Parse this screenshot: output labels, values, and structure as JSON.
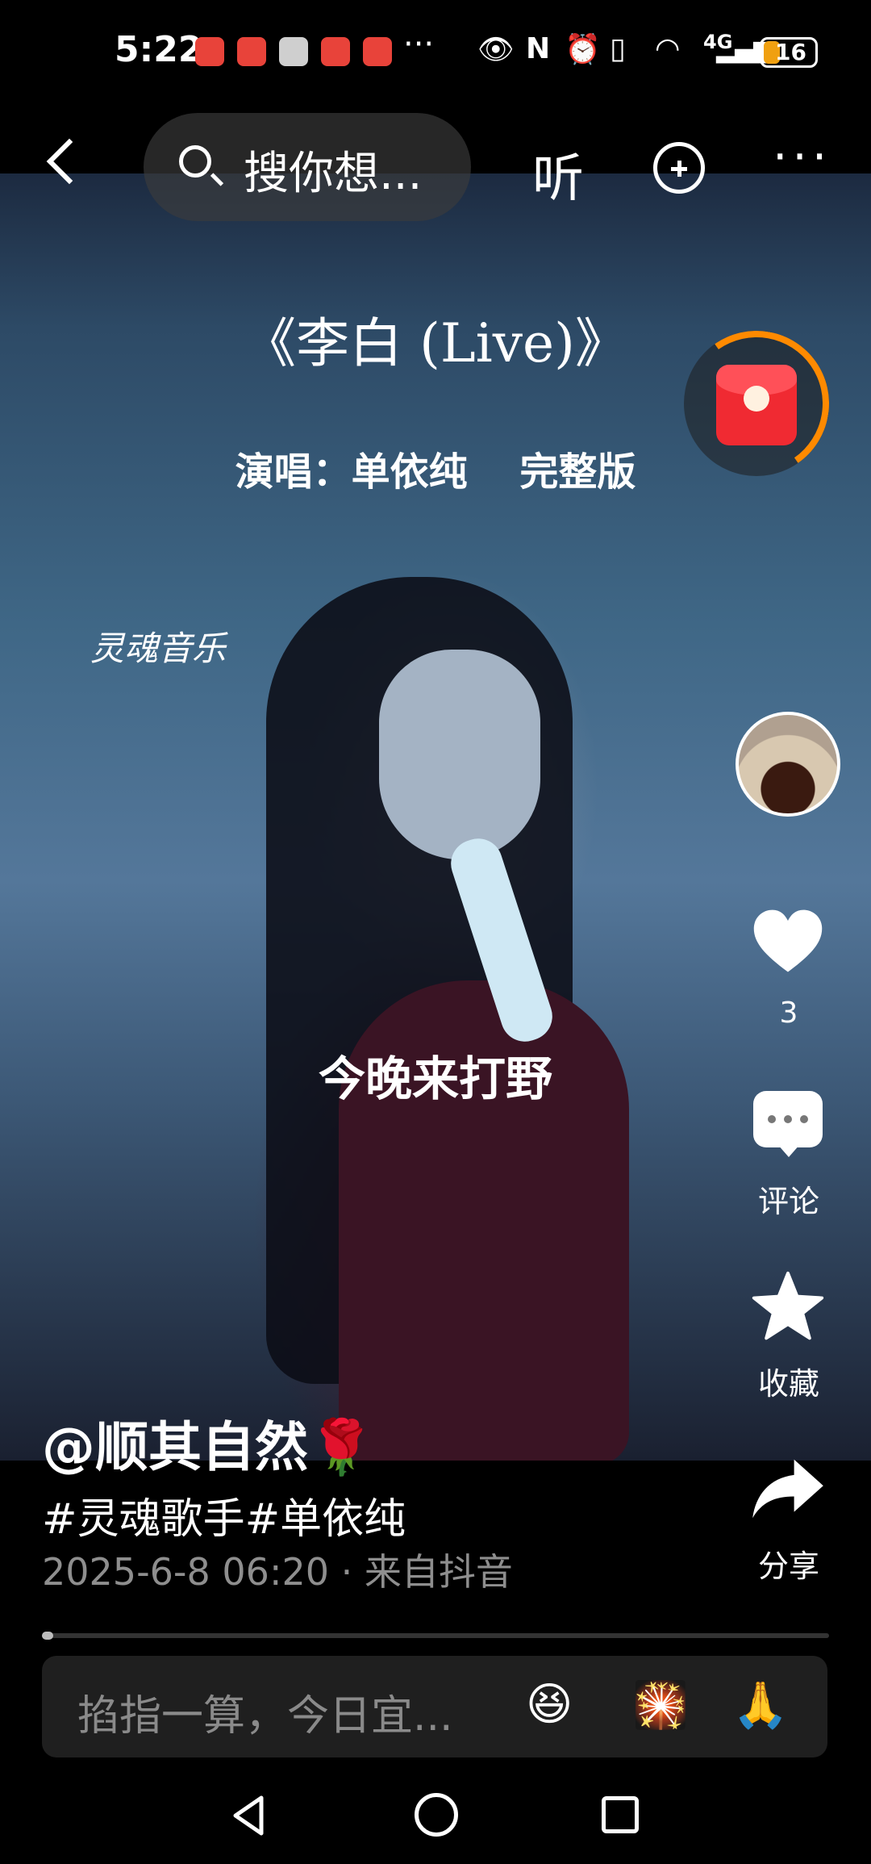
{
  "status_bar": {
    "time": "5:22",
    "more": "···",
    "network": "4G",
    "battery": "16"
  },
  "top_nav": {
    "search_placeholder": "搜你想...",
    "listen_label": "听",
    "more_label": "···"
  },
  "video": {
    "title": "《李白 (Live)》",
    "subtitle": "演唱：单依纯　 完整版",
    "watermark": "灵魂音乐",
    "lyric": "今晚来打野"
  },
  "right_rail": {
    "like_count": "3",
    "comment_label": "评论",
    "favorite_label": "收藏",
    "share_label": "分享"
  },
  "post": {
    "author": "@顺其自然🌹",
    "hashtags": "#灵魂歌手#单依纯",
    "meta": "2025-6-8 06:20 · 来自抖音"
  },
  "progress": {
    "fraction": 0.01
  },
  "comment_bar": {
    "placeholder": "掐指一算，今日宜...",
    "emojis": [
      "😆",
      "🎇",
      "🙏"
    ]
  },
  "colors": {
    "accent_orange": "#ff8a00",
    "red_packet": "#f02a32",
    "meta_gray": "#8e8e8e"
  },
  "icons": [
    "back-icon",
    "search-icon",
    "add-icon",
    "more-icon",
    "red-packet-icon",
    "heart-icon",
    "comment-icon",
    "star-icon",
    "share-icon"
  ]
}
